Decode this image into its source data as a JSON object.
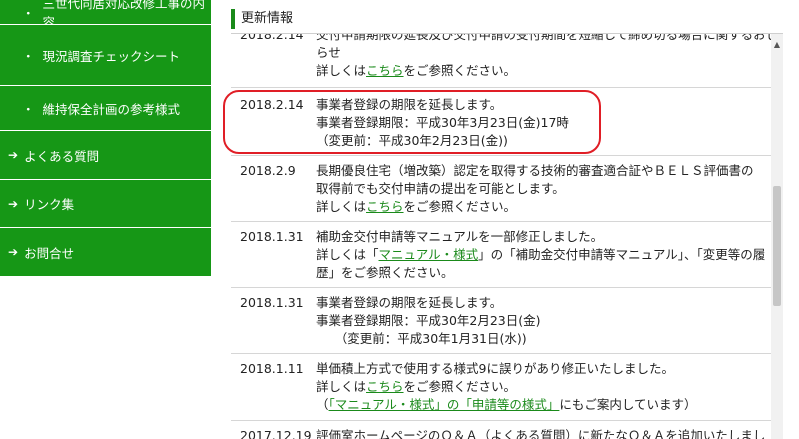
{
  "sidebar": {
    "items": [
      {
        "bullet": "・",
        "label": "三世代同居対応改修工事の内容",
        "icon": "bullet"
      },
      {
        "bullet": "・",
        "label": "現況調査チェックシート",
        "icon": "bullet"
      },
      {
        "bullet": "・",
        "label": "維持保全計画の参考様式",
        "icon": "bullet"
      },
      {
        "arrow": "➔",
        "label": "よくある質問",
        "icon": "arrow-right-icon"
      },
      {
        "arrow": "➔",
        "label": "リンク集",
        "icon": "arrow-right-icon"
      },
      {
        "arrow": "➔",
        "label": "お問合せ",
        "icon": "arrow-right-icon"
      }
    ],
    "color": "#169716"
  },
  "section": {
    "title": "更新情報"
  },
  "highlight_color": "#e01e26",
  "news": [
    {
      "date": "2018.2.14",
      "lines": [
        {
          "text": "交付申請期限の延長及び交付申請の受付期間を短縮して締め切る場合に関するおし"
        },
        {
          "text": "らせ"
        },
        {
          "pre": "詳しくは",
          "link": "こちら",
          "post": "をご参照ください。"
        }
      ]
    },
    {
      "date": "2018.2.14",
      "lines": [
        {
          "text": "事業者登録の期限を延長します。"
        },
        {
          "text": "事業者登録期限：平成30年3月23日(金)17時"
        },
        {
          "text": "（変更前：平成30年2月23日(金))"
        }
      ]
    },
    {
      "date": "2018.2.9",
      "lines": [
        {
          "text": "長期優良住宅（増改築）認定を取得する技術的審査適合証やＢＥＬＳ評価書の"
        },
        {
          "text": "取得前でも交付申請の提出を可能とします。"
        },
        {
          "pre": "詳しくは",
          "link": "こちら",
          "post": "をご参照ください。"
        }
      ]
    },
    {
      "date": "2018.1.31",
      "lines": [
        {
          "text": "補助金交付申請等マニュアルを一部修正しました。"
        },
        {
          "pre": "詳しくは「",
          "link": "マニュアル・様式",
          "post": "」の「補助金交付申請等マニュアル」、「変更等の履"
        },
        {
          "text": "歴」をご参照ください。"
        }
      ]
    },
    {
      "date": "2018.1.31",
      "lines": [
        {
          "text": "事業者登録の期限を延長します。"
        },
        {
          "text": "事業者登録期限：平成30年2月23日(金)"
        },
        {
          "text": "　　（変更前：平成30年1月31日(水))"
        }
      ]
    },
    {
      "date": "2018.1.11",
      "lines": [
        {
          "text": "単価積上方式で使用する様式9に誤りがあり修正いたしました。"
        },
        {
          "pre": "詳しくは",
          "link": "こちら",
          "post": "をご参照ください。"
        },
        {
          "pre": "（",
          "link": "「マニュアル・様式」の「申請等の様式」",
          "post": "にもご案内しています）"
        }
      ]
    },
    {
      "date": "2017.12.19",
      "lines": [
        {
          "text": "評価室ホームページのＱ＆Ａ（よくある質問）に新たなＱ＆Ａを追加いたしまし"
        }
      ]
    }
  ],
  "scrollbar": {
    "up_icon": "▲"
  }
}
